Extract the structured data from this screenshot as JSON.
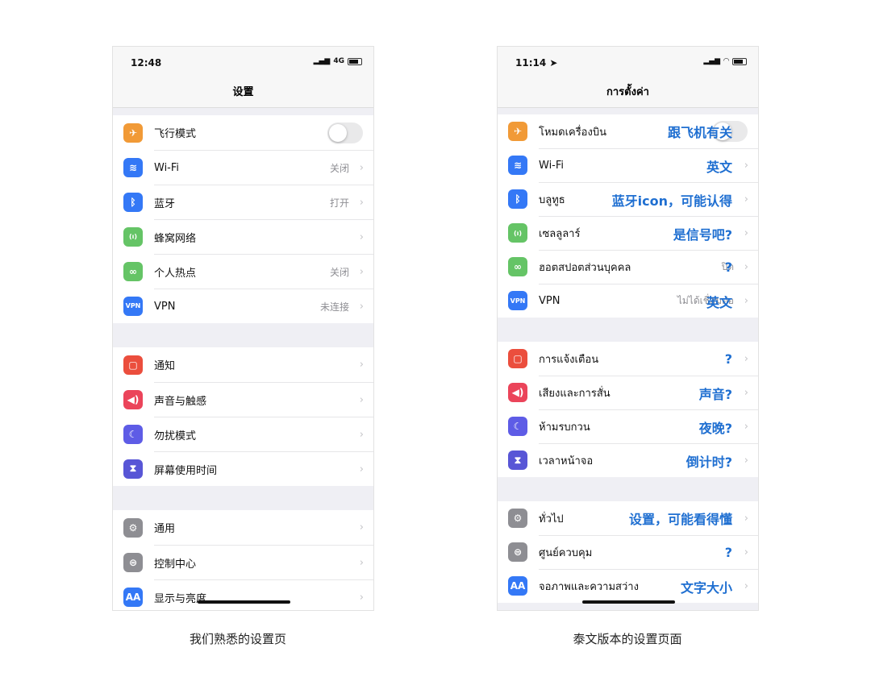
{
  "phones": [
    {
      "time": "12:48",
      "network": "4G",
      "title": "设置",
      "row_height": 43,
      "groups": [
        {
          "rows": [
            {
              "label": "飞行模式",
              "icon": "airplane-icon",
              "glyph": "✈",
              "color": "#f19a37",
              "toggle": false
            },
            {
              "label": "Wi-Fi",
              "icon": "wifi-icon",
              "glyph": "≋",
              "color": "#3478f6",
              "value": "关闭"
            },
            {
              "label": "蓝牙",
              "icon": "bluetooth-icon",
              "glyph": "ᛒ",
              "color": "#3478f6",
              "value": "打开"
            },
            {
              "label": "蜂窝网络",
              "icon": "cellular-icon",
              "glyph": "(ı)",
              "color": "#65c466"
            },
            {
              "label": "个人热点",
              "icon": "hotspot-icon",
              "glyph": "∞",
              "color": "#65c466",
              "value": "关闭"
            },
            {
              "label": "VPN",
              "icon": "vpn-icon",
              "glyph": "VPN",
              "color": "#3478f6",
              "value": "未连接"
            }
          ]
        },
        {
          "rows": [
            {
              "label": "通知",
              "icon": "notifications-icon",
              "glyph": "▢",
              "color": "#eb4e3d"
            },
            {
              "label": "声音与触感",
              "icon": "sound-icon",
              "glyph": "◀)",
              "color": "#eb445a"
            },
            {
              "label": "勿扰模式",
              "icon": "moon-icon",
              "glyph": "☾",
              "color": "#5e5ce6"
            },
            {
              "label": "屏幕使用时间",
              "icon": "hourglass-icon",
              "glyph": "⧗",
              "color": "#5856d6"
            }
          ]
        },
        {
          "rows": [
            {
              "label": "通用",
              "icon": "gear-icon",
              "glyph": "⚙",
              "color": "#8e8e93"
            },
            {
              "label": "控制中心",
              "icon": "control-center-icon",
              "glyph": "⊜",
              "color": "#8e8e93"
            },
            {
              "label": "显示与亮度",
              "icon": "display-icon",
              "glyph": "AA",
              "color": "#3478f6"
            }
          ]
        }
      ]
    },
    {
      "time": "11:14 ➤",
      "network": "",
      "title": "การตั้งค่า",
      "row_height": 42,
      "groups": [
        {
          "rows": [
            {
              "label": "โหมดเครื่องบิน",
              "icon": "airplane-icon",
              "glyph": "✈",
              "color": "#f19a37",
              "toggle": false,
              "note": "跟飞机有关"
            },
            {
              "label": "Wi-Fi",
              "icon": "wifi-icon",
              "glyph": "≋",
              "color": "#3478f6",
              "note": "英文"
            },
            {
              "label": "บลูทูธ",
              "icon": "bluetooth-icon",
              "glyph": "ᛒ",
              "color": "#3478f6",
              "note": "蓝牙icon，可能认得"
            },
            {
              "label": "เซลลูลาร์",
              "icon": "cellular-icon",
              "glyph": "(ı)",
              "color": "#65c466",
              "note": "是信号吧?"
            },
            {
              "label": "ฮอตสปอตส่วนบุคคล",
              "icon": "hotspot-icon",
              "glyph": "∞",
              "color": "#65c466",
              "value": "ปิด",
              "note": "?"
            },
            {
              "label": "VPN",
              "icon": "vpn-icon",
              "glyph": "VPN",
              "color": "#3478f6",
              "value": "ไม่ได้เชื่อมต่อ",
              "note": "英文"
            }
          ]
        },
        {
          "rows": [
            {
              "label": "การแจ้งเตือน",
              "icon": "notifications-icon",
              "glyph": "▢",
              "color": "#eb4e3d",
              "note": "?"
            },
            {
              "label": "เสียงและการสั่น",
              "icon": "sound-icon",
              "glyph": "◀)",
              "color": "#eb445a",
              "note": "声音?"
            },
            {
              "label": "ห้ามรบกวน",
              "icon": "moon-icon",
              "glyph": "☾",
              "color": "#5e5ce6",
              "note": "夜晚?"
            },
            {
              "label": "เวลาหน้าจอ",
              "icon": "hourglass-icon",
              "glyph": "⧗",
              "color": "#5856d6",
              "note": "倒计时?"
            }
          ]
        },
        {
          "rows": [
            {
              "label": "ทั่วไป",
              "icon": "gear-icon",
              "glyph": "⚙",
              "color": "#8e8e93",
              "note": "设置，可能看得懂"
            },
            {
              "label": "ศูนย์ควบคุม",
              "icon": "control-center-icon",
              "glyph": "⊜",
              "color": "#8e8e93",
              "note": "?"
            },
            {
              "label": "จอภาพและความสว่าง",
              "icon": "display-icon",
              "glyph": "AA",
              "color": "#3478f6",
              "note": "文字大小"
            }
          ]
        }
      ]
    }
  ],
  "captions": [
    "我们熟悉的设置页",
    "泰文版本的设置页面"
  ]
}
